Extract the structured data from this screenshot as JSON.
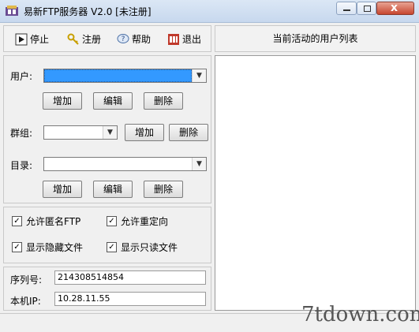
{
  "window": {
    "title": "易新FTP服务器 V2.0 [未注册]",
    "close_glyph": "x"
  },
  "toolbar": {
    "stop_label": "停止",
    "register_label": "注册",
    "help_label": "帮助",
    "exit_label": "退出",
    "icons": [
      "play-icon",
      "key-icon",
      "help-bubble-icon",
      "exit-icon"
    ]
  },
  "user_list": {
    "header": "当前活动的用户列表"
  },
  "form": {
    "user_label": "用户:",
    "group_label": "群组:",
    "dir_label": "目录:",
    "user_value": "",
    "group_value": "",
    "dir_value": "",
    "add_label": "增加",
    "edit_label": "编辑",
    "delete_label": "删除"
  },
  "options": {
    "allow_anonymous": {
      "label": "允许匿名FTP",
      "checked": true
    },
    "allow_redirect": {
      "label": "允许重定向",
      "checked": true
    },
    "show_hidden": {
      "label": "显示隐藏文件",
      "checked": true
    },
    "show_readonly": {
      "label": "显示只读文件",
      "checked": true
    },
    "check_glyph": "✓"
  },
  "info": {
    "serial_label": "序列号:",
    "serial_value": "214308514854",
    "ip_label": "本机IP:",
    "ip_value": "10.28.11.55"
  },
  "watermark": "7tdown.com",
  "colors": {
    "selection": "#3399ff",
    "close_button": "#c7462f"
  }
}
